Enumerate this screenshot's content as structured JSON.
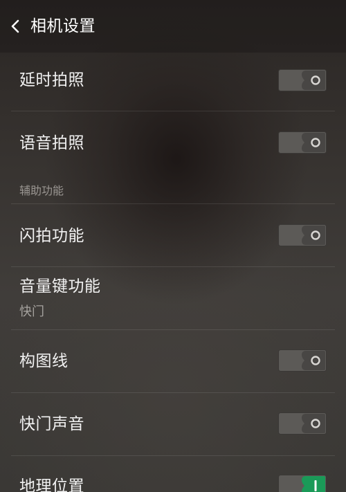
{
  "header": {
    "title": "相机设置",
    "back_icon": "chevron-left-icon"
  },
  "settings": [
    {
      "label": "延时拍照",
      "enabled": false
    },
    {
      "label": "语音拍照",
      "enabled": false
    }
  ],
  "assist_section": {
    "title": "辅助功能",
    "items": [
      {
        "label": "闪拍功能",
        "enabled": false
      },
      {
        "label": "音量键功能",
        "value": "快门"
      },
      {
        "label": "构图线",
        "enabled": false
      },
      {
        "label": "快门声音",
        "enabled": false
      },
      {
        "label": "地理位置",
        "enabled": true
      }
    ]
  },
  "colors": {
    "toggle_off": "#5c5a57",
    "toggle_on": "#1a9a58",
    "text_primary": "#f2f2f2",
    "text_secondary": "#a6a39f"
  }
}
